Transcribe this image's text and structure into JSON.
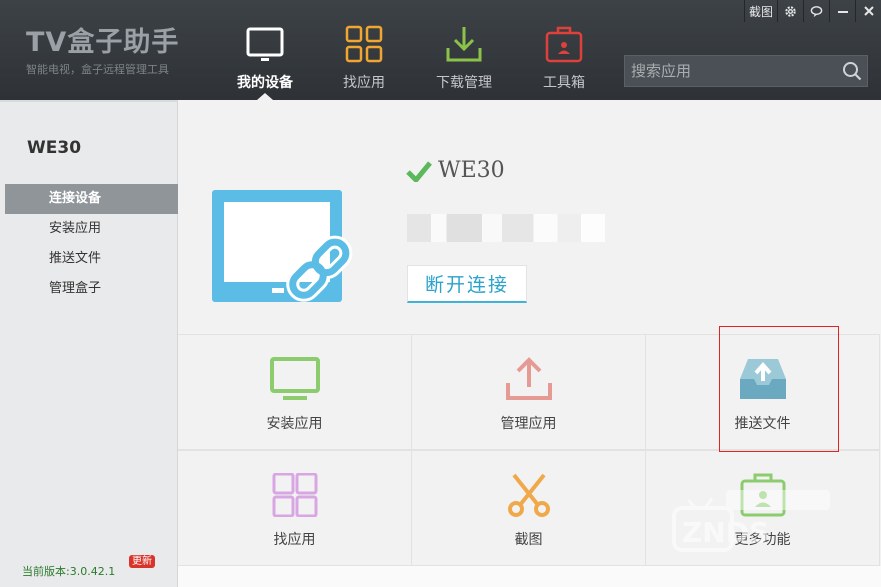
{
  "app": {
    "title": "TV盒子助手",
    "subtitle": "智能电视，盒子远程管理工具"
  },
  "titlebar": {
    "screenshot_label": "截图"
  },
  "nav": [
    {
      "label": "我的设备",
      "icon": "tv-icon",
      "active": true
    },
    {
      "label": "找应用",
      "icon": "apps-grid-icon",
      "active": false
    },
    {
      "label": "下载管理",
      "icon": "download-icon",
      "active": false
    },
    {
      "label": "工具箱",
      "icon": "toolbox-icon",
      "active": false
    }
  ],
  "search": {
    "placeholder": "搜索应用"
  },
  "sidebar": {
    "device_name": "WE30",
    "items": [
      {
        "label": "连接设备",
        "active": true
      },
      {
        "label": "安装应用",
        "active": false
      },
      {
        "label": "推送文件",
        "active": false
      },
      {
        "label": "管理盒子",
        "active": false
      }
    ],
    "version": "当前版本:3.0.42.1",
    "update_badge": "更新"
  },
  "connection": {
    "device_name": "WE30",
    "disconnect_label": "断开连接"
  },
  "tiles": [
    {
      "label": "安装应用",
      "icon": "monitor-icon",
      "color": "#8ccc6e"
    },
    {
      "label": "管理应用",
      "icon": "upload-icon",
      "color": "#e69a94"
    },
    {
      "label": "推送文件",
      "icon": "inbox-upload-icon",
      "color": "#7fb8cc"
    },
    {
      "label": "找应用",
      "icon": "apps-grid-icon",
      "color": "#d7a6e3"
    },
    {
      "label": "截图",
      "icon": "scissors-icon",
      "color": "#f0a94a"
    },
    {
      "label": "更多功能",
      "icon": "toolbox-icon",
      "color": "#8ccc6e"
    }
  ],
  "colors": {
    "header_bg": "#34383c",
    "accent_blue": "#2ba3cc",
    "check_green": "#5cb85c",
    "highlight_red": "#e02424"
  }
}
